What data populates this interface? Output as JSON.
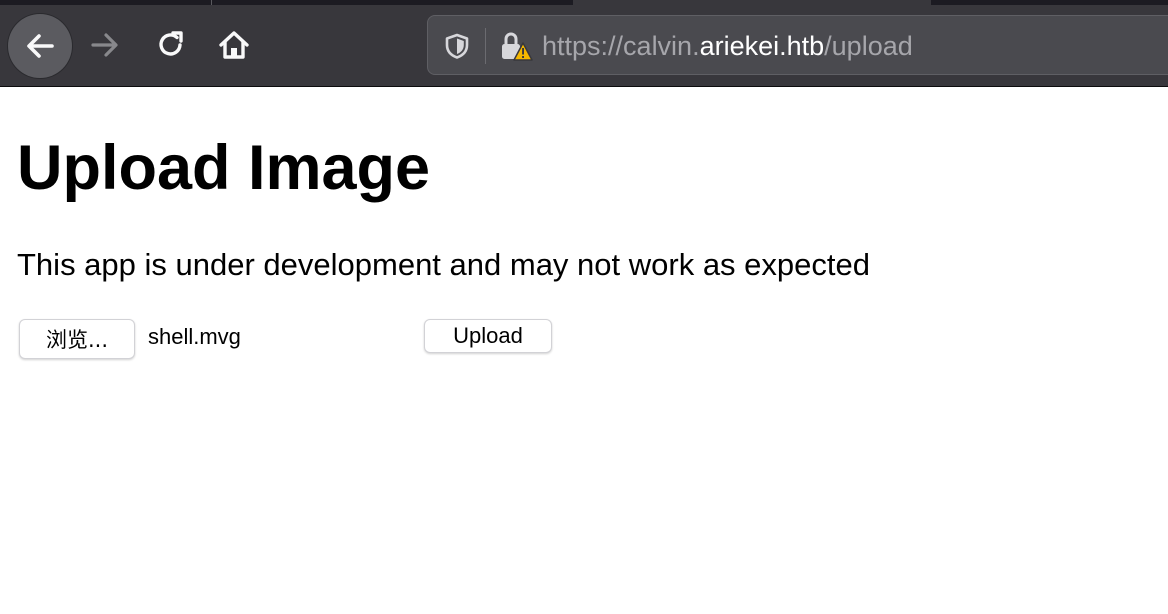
{
  "browser": {
    "url": {
      "scheme": "https://",
      "subdomain": "calvin.",
      "domain": "ariekei.htb",
      "path": "/upload"
    },
    "icons": {
      "back": "back-arrow-icon",
      "forward": "forward-arrow-icon",
      "reload": "reload-icon",
      "home": "home-icon",
      "shield": "tracking-protection-shield-icon",
      "lock": "insecure-lock-warning-icon"
    }
  },
  "page": {
    "title": "Upload Image",
    "note": "This app is under development and may not work as expected",
    "form": {
      "browse_label": "浏览...",
      "file_name": "shell.mvg",
      "upload_label": "Upload"
    }
  },
  "colors": {
    "chrome_bg": "#38373c",
    "urlbar_bg": "#4a4a4f",
    "url_dim_text": "#a6a6ab",
    "url_host_text": "#ffffff",
    "warning_yellow": "#f5b800"
  }
}
